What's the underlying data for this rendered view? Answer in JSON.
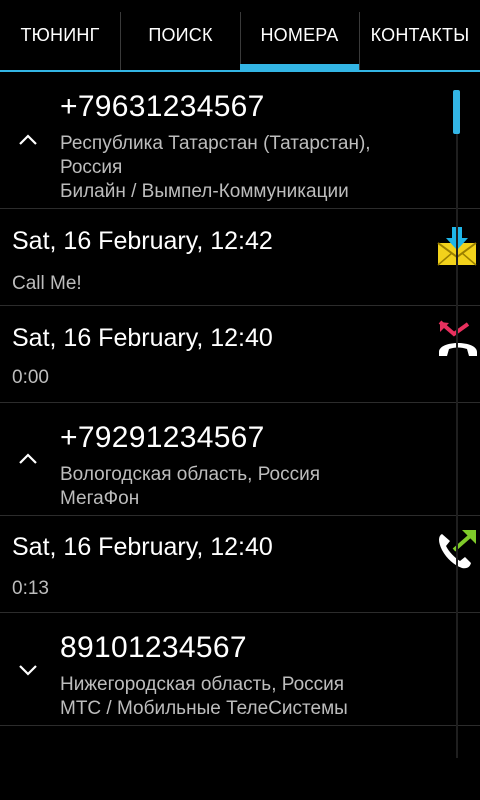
{
  "tabs": [
    {
      "label": "ТЮНИНГ",
      "selected": false
    },
    {
      "label": "ПОИСК",
      "selected": false
    },
    {
      "label": "НОМЕРА",
      "selected": true
    },
    {
      "label": "КОНТАКТЫ",
      "selected": false
    }
  ],
  "accent_color": "#33b5e5",
  "groups": [
    {
      "number": "+79631234567",
      "region_line1": "Республика Татарстан (Татарстан),",
      "region_line2": "Россия",
      "operator": "Билайн / Вымпел-Коммуникации",
      "expanded": true,
      "chevron_icon": "chevron-up-icon"
    },
    {
      "number": "+79291234567",
      "region": "Вологодская область, Россия",
      "operator": "МегаФон",
      "expanded": true,
      "chevron_icon": "chevron-up-icon"
    },
    {
      "number": "89101234567",
      "region": "Нижегородская область, Россия",
      "operator": "МТС / Мобильные ТелеСистемы",
      "expanded": false,
      "chevron_icon": "chevron-down-icon"
    }
  ],
  "calls": [
    {
      "date": "Sat, 16 February, 12:42",
      "detail": "Call Me!",
      "icon": "incoming-sms-icon"
    },
    {
      "date": "Sat, 16 February, 12:40",
      "detail": "0:00",
      "icon": "missed-call-icon"
    },
    {
      "date": "Sat, 16 February, 12:40",
      "detail": "0:13",
      "icon": "outgoing-call-icon"
    }
  ]
}
